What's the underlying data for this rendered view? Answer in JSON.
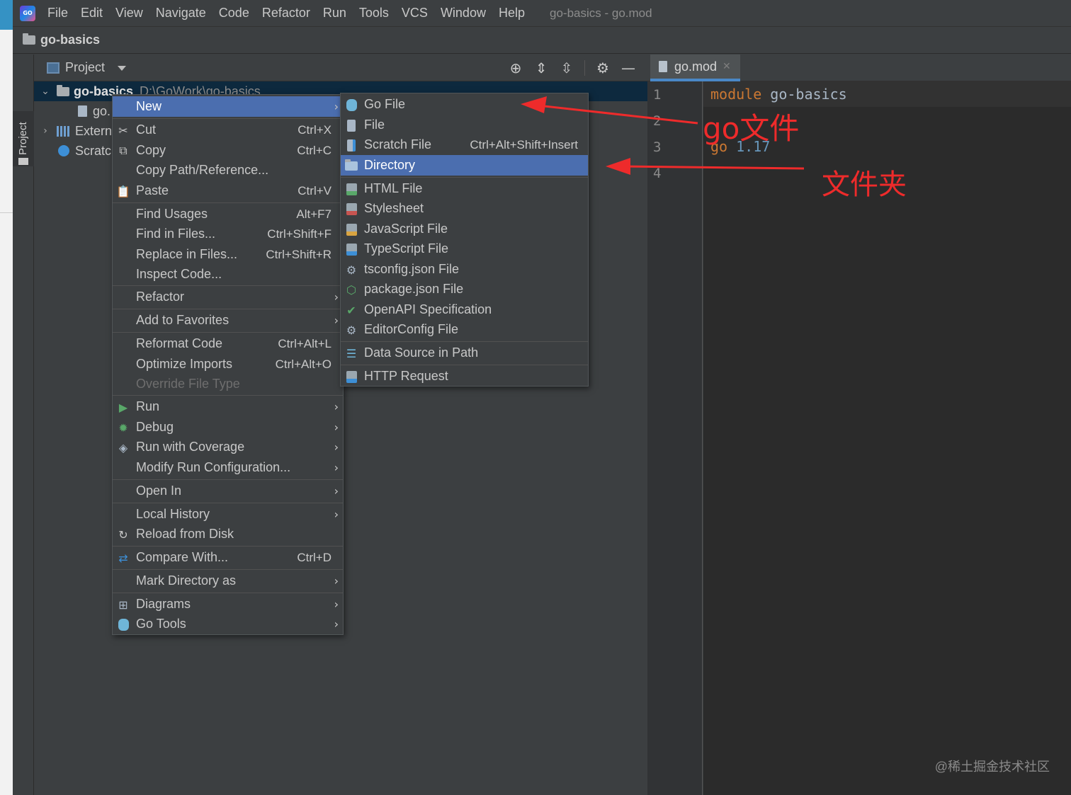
{
  "menubar": {
    "items": [
      "File",
      "Edit",
      "View",
      "Navigate",
      "Code",
      "Refactor",
      "Run",
      "Tools",
      "VCS",
      "Window",
      "Help"
    ],
    "window_title": "go-basics - go.mod"
  },
  "breadcrumb": {
    "project": "go-basics"
  },
  "tool_stripe": {
    "project_tab": "Project"
  },
  "project_panel": {
    "title": "Project",
    "root": {
      "name": "go-basics",
      "path": "D:\\GoWork\\go-basics"
    },
    "child_file": "go.",
    "external": "Extern",
    "scratches": "Scratcl"
  },
  "editor": {
    "tab": "go.mod",
    "line_numbers": [
      "1",
      "2",
      "3",
      "4"
    ],
    "lines": {
      "l1_kw": "module",
      "l1_id": "go-basics",
      "l3_kw": "go",
      "l3_num": "1.17"
    }
  },
  "context_menu": {
    "new": "New",
    "cut": "Cut",
    "cut_sc": "Ctrl+X",
    "copy": "Copy",
    "copy_sc": "Ctrl+C",
    "copy_path": "Copy Path/Reference...",
    "paste": "Paste",
    "paste_sc": "Ctrl+V",
    "find_usages": "Find Usages",
    "find_usages_sc": "Alt+F7",
    "find_in_files": "Find in Files...",
    "find_in_files_sc": "Ctrl+Shift+F",
    "replace_in_files": "Replace in Files...",
    "replace_in_files_sc": "Ctrl+Shift+R",
    "inspect_code": "Inspect Code...",
    "refactor": "Refactor",
    "add_to_favorites": "Add to Favorites",
    "reformat_code": "Reformat Code",
    "reformat_code_sc": "Ctrl+Alt+L",
    "optimize_imports": "Optimize Imports",
    "optimize_imports_sc": "Ctrl+Alt+O",
    "override_file_type": "Override File Type",
    "run": "Run",
    "debug": "Debug",
    "run_with_coverage": "Run with Coverage",
    "modify_run_config": "Modify Run Configuration...",
    "open_in": "Open In",
    "local_history": "Local History",
    "reload_from_disk": "Reload from Disk",
    "compare_with": "Compare With...",
    "compare_with_sc": "Ctrl+D",
    "mark_directory_as": "Mark Directory as",
    "diagrams": "Diagrams",
    "go_tools": "Go Tools"
  },
  "new_submenu": {
    "go_file": "Go File",
    "file": "File",
    "scratch_file": "Scratch File",
    "scratch_file_sc": "Ctrl+Alt+Shift+Insert",
    "directory": "Directory",
    "html_file": "HTML File",
    "stylesheet": "Stylesheet",
    "javascript_file": "JavaScript File",
    "typescript_file": "TypeScript File",
    "tsconfig_file": "tsconfig.json File",
    "package_json_file": "package.json File",
    "openapi_spec": "OpenAPI Specification",
    "editorconfig_file": "EditorConfig File",
    "data_source_in_path": "Data Source in Path",
    "http_request": "HTTP Request"
  },
  "annotations": {
    "go_file": "go文件",
    "folder": "文件夹"
  },
  "watermark": "@稀土掘金技术社区",
  "colors": {
    "highlight": "#4b6eaf",
    "annotation": "#ee2b2b",
    "background": "#3c3f41",
    "editor_bg": "#2b2b2b"
  }
}
